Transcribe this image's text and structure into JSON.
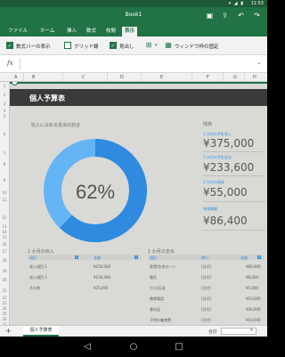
{
  "status": {
    "time": "11:53",
    "signals": "▾ ◢ ▮"
  },
  "app": {
    "title": "Book1",
    "icons": [
      "save-icon",
      "share-icon",
      "undo-icon",
      "redo-icon"
    ]
  },
  "ribbon_tabs": [
    "ファイル",
    "ホーム",
    "挿入",
    "数式",
    "校閲",
    "表示"
  ],
  "active_tab": "表示",
  "ribbon": {
    "formula_bar_label": "数式バーの表示",
    "gridlines_label": "グリッド線",
    "headings_label": "見出し",
    "freeze_label": "ウィンドウ枠の固定",
    "formula_bar_checked": true,
    "gridlines_checked": false,
    "headings_checked": true
  },
  "formula_bar": {
    "fx": "fx",
    "value": ""
  },
  "columns": [
    "A",
    "B",
    "C",
    "D",
    "E",
    "F",
    "G",
    "H"
  ],
  "rows": [
    "1",
    "2",
    "3",
    "4",
    "5",
    "6",
    "7",
    "8",
    "9",
    "10",
    "11",
    "12",
    "13",
    "14",
    "15",
    "16",
    "17",
    "18",
    "19",
    "20",
    "21",
    "22",
    "23",
    "24",
    "25",
    "26",
    "27"
  ],
  "sheet": {
    "title": "個人予算表",
    "donut_caption": "収入に占める支出の割合",
    "donut_value": "62%",
    "donut_percent": 62,
    "summary_header": "残高",
    "summary": [
      {
        "label": "1 か月の予定収入",
        "value": "¥375,000"
      },
      {
        "label": "1 か月の予定支出",
        "value": "¥233,600"
      },
      {
        "label": "1 か月の残高",
        "value": "¥55,000"
      },
      {
        "label": "残高概算",
        "value": "¥86,400"
      }
    ],
    "income": {
      "title": "1 か月の収入",
      "headers": [
        "項目",
        "金額"
      ],
      "rows": [
        [
          "収入項目 1",
          "¥250,000"
        ],
        [
          "収入項目 2",
          "¥100,000"
        ],
        [
          "その他",
          "¥25,000"
        ]
      ]
    },
    "expense": {
      "title": "1 か月の支出",
      "headers": [
        "項目",
        "期日",
        "金額"
      ],
      "rows": [
        [
          "家賃/住宅ローン",
          "[日付]",
          "¥80,000"
        ],
        [
          "電気",
          "[日付]",
          "¥8,000"
        ],
        [
          "ガス/石油",
          "[日付]",
          "¥5,000"
        ],
        [
          "携帯電話",
          "[日付]",
          "¥10,000"
        ],
        [
          "食料品",
          "[日付]",
          "¥40,000"
        ],
        [
          "子供の養育費",
          "[日付]",
          "¥10,000"
        ]
      ]
    }
  },
  "sheet_tab": "個人予算表",
  "footer": {
    "sum_label": "合計"
  },
  "colors": {
    "excel_green": "#217346",
    "accent_blue": "#2f8ae0",
    "donut_light": "#64b5f6"
  }
}
